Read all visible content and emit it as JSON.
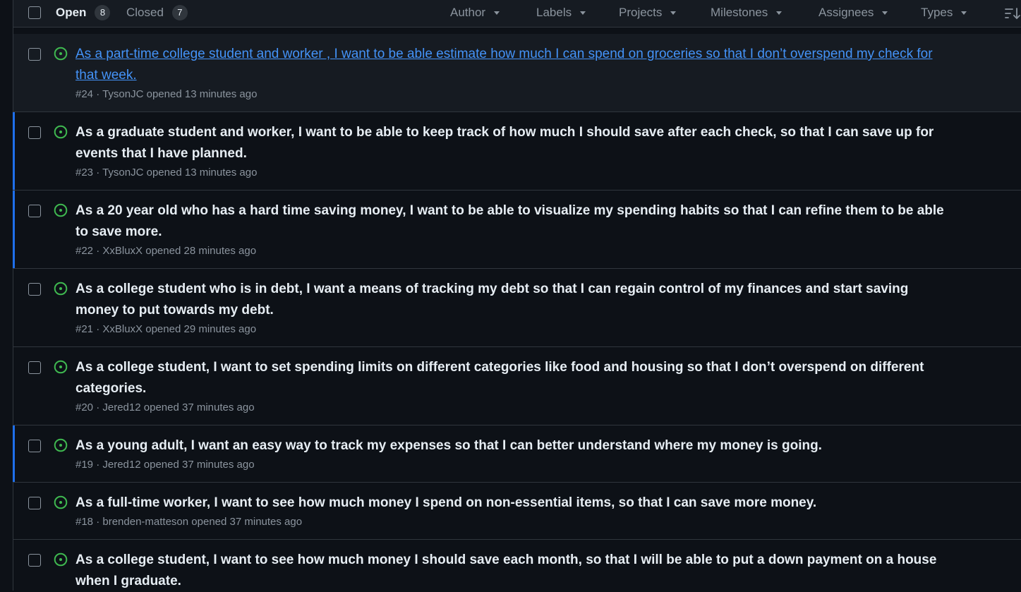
{
  "header": {
    "open_label": "Open",
    "open_count": "8",
    "closed_label": "Closed",
    "closed_count": "7",
    "filters": [
      "Author",
      "Labels",
      "Projects",
      "Milestones",
      "Assignees",
      "Types"
    ]
  },
  "issues": [
    {
      "title": "As a part-time college student and worker , I want to be able estimate how much I can spend on groceries so that I don’t overspend my check for that week.",
      "number": "#24",
      "author": "TysonJC",
      "opened": "opened 13 minutes ago"
    },
    {
      "title": "As a graduate student and worker, I want to be able to keep track of how much I should save after each check, so that I can save up for events that I have planned.",
      "number": "#23",
      "author": "TysonJC",
      "opened": "opened 13 minutes ago"
    },
    {
      "title": "As a 20 year old who has a hard time saving money, I want to be able to visualize my spending habits so that I can refine them to be able to save more.",
      "number": "#22",
      "author": "XxBluxX",
      "opened": "opened 28 minutes ago"
    },
    {
      "title": "As a college student who is in debt, I want a means of tracking my debt so that I can regain control of my finances and start saving money to put towards my debt.",
      "number": "#21",
      "author": "XxBluxX",
      "opened": "opened 29 minutes ago"
    },
    {
      "title": "As a college student, I want to set spending limits on different categories like food and housing so that I don’t overspend on different categories.",
      "number": "#20",
      "author": "Jered12",
      "opened": "opened 37 minutes ago"
    },
    {
      "title": "As a young adult, I want an easy way to track my expenses so that I can better understand where my money is going.",
      "number": "#19",
      "author": "Jered12",
      "opened": "opened 37 minutes ago"
    },
    {
      "title": "As a full-time worker, I want to see how much money I spend on non-essential items, so that I can save more money.",
      "number": "#18",
      "author": "brenden-matteson",
      "opened": "opened 37 minutes ago"
    },
    {
      "title": "As a college student, I want to see how much money I should save each month, so that I will be able to put a down payment on a house when I graduate.",
      "number": "",
      "author": "",
      "opened": ""
    }
  ],
  "colors": {
    "open_icon": "#3fb950",
    "link": "#4493f8",
    "selection_bar": "#1f6feb"
  }
}
